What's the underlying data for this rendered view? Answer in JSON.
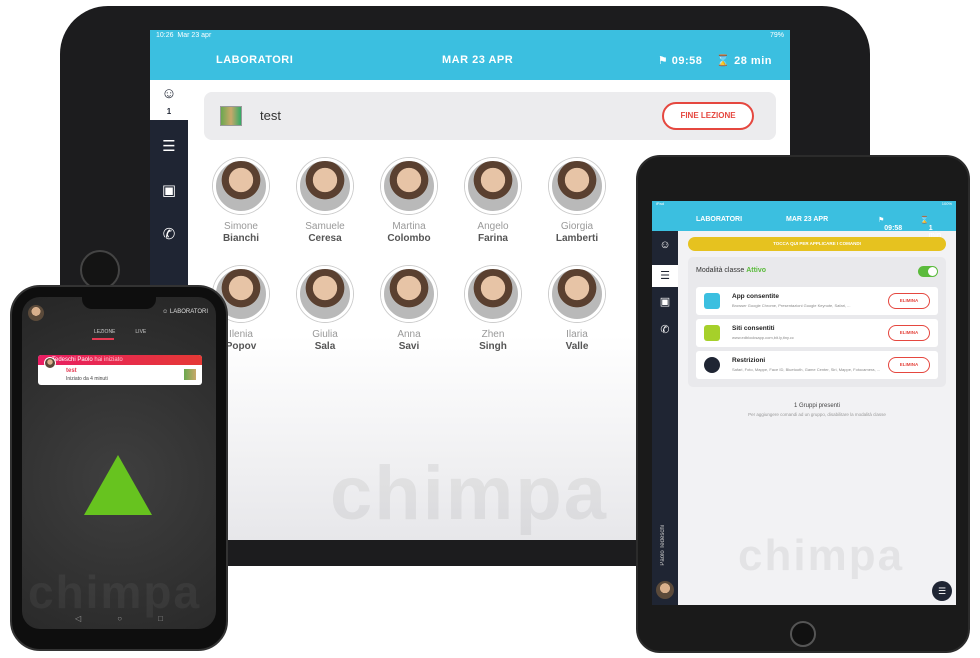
{
  "brand_watermark": "chimpa",
  "big_tablet": {
    "status": {
      "time": "10:26",
      "date": "Mar 23 apr",
      "battery": "79%"
    },
    "header": {
      "title": "LABORATORI",
      "date": "MAR 23 APR",
      "clock": "09:58",
      "duration": "28 min"
    },
    "sidebar": {
      "students_count": "1"
    },
    "lesson": {
      "name": "test",
      "end_button": "FINE LEZIONE"
    },
    "students": [
      {
        "first": "Simone",
        "last": "Bianchi"
      },
      {
        "first": "Samuele",
        "last": "Ceresa"
      },
      {
        "first": "Martina",
        "last": "Colombo"
      },
      {
        "first": "Angelo",
        "last": "Farina"
      },
      {
        "first": "Giorgia",
        "last": "Lamberti"
      },
      {
        "first": "Ilenia",
        "last": "Popov"
      },
      {
        "first": "Giulia",
        "last": "Sala"
      },
      {
        "first": "Anna",
        "last": "Savi"
      },
      {
        "first": "Zhen",
        "last": "Singh"
      },
      {
        "first": "Ilaria",
        "last": "Valle"
      }
    ]
  },
  "phone": {
    "label": "LABORATORI",
    "tabs": [
      "LEZIONE",
      "LIVE"
    ],
    "notification": {
      "sender": "Tedeschi Paolo",
      "suffix": "hai iniziato",
      "title": "test",
      "subtitle": "Iniziato da 4 minuti"
    }
  },
  "small_tablet": {
    "status": {
      "left": "iPad",
      "battery": "100%"
    },
    "header": {
      "title": "LABORATORI",
      "date": "MAR 23 APR",
      "clock": "09:58",
      "duration": "1 min"
    },
    "banner": "TOCCA QUI PER APPLICARE I COMANDI",
    "mode_label": "Modalità classe",
    "mode_state": "Attivo",
    "rows": [
      {
        "title": "App consentite",
        "subtitle": "Browser Google Chrome, Presentazioni Google Keynote, Safari, ...",
        "button": "ELIMINA",
        "color": "#3bbfe0"
      },
      {
        "title": "Siti consentiti",
        "subtitle": "www.edblocksapp.com,bit.ly,tiny.cc",
        "button": "ELIMINA",
        "color": "#a6d02a"
      },
      {
        "title": "Restrizioni",
        "subtitle": "Safari, Foto, Mappe, Face ID, Bluetooth, Game Center, Siri, Mappe, Fotocamera, ...",
        "button": "ELIMINA",
        "color": "#1f2533"
      }
    ],
    "groups_title": "1 Gruppi presenti",
    "groups_hint": "Per aggiungere comandi ad un gruppo, disabilitare la modalità classe",
    "user_name": "Paolo Tedeschi"
  }
}
